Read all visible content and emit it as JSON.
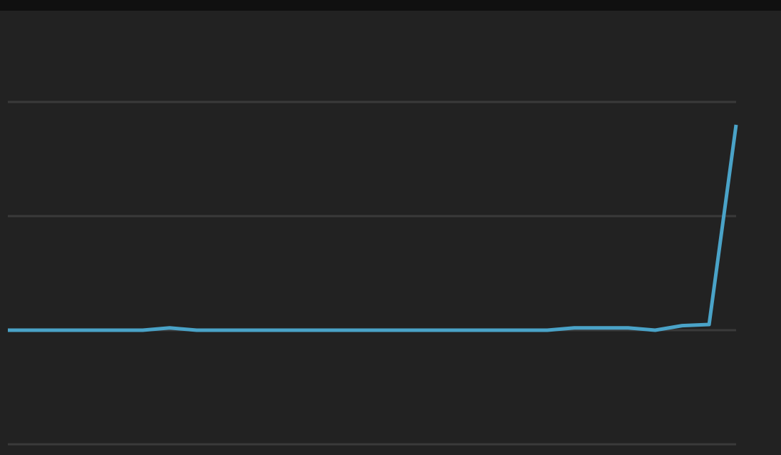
{
  "colors": {
    "background": "#222222",
    "top_bar": "#101010",
    "grid": "#3a3a3a",
    "line": "#4aa3c8"
  },
  "chart_data": {
    "type": "line",
    "title": "",
    "xlabel": "",
    "ylabel": "",
    "grid": true,
    "ylim": [
      -1,
      3
    ],
    "yticks": [
      -1,
      0,
      1,
      2
    ],
    "x": [
      0,
      1,
      2,
      3,
      4,
      5,
      6,
      7,
      8,
      9,
      10,
      11,
      12,
      13,
      14,
      15,
      16,
      17,
      18,
      19,
      20,
      21,
      22,
      23,
      24,
      25,
      26,
      27
    ],
    "series": [
      {
        "values": [
          0,
          0,
          0,
          0,
          0,
          0,
          0.02,
          0,
          0,
          0,
          0,
          0,
          0,
          0,
          0,
          0,
          0,
          0,
          0,
          0,
          0,
          0.02,
          0.02,
          0.02,
          0,
          0.04,
          0.05,
          1.8
        ]
      }
    ]
  }
}
